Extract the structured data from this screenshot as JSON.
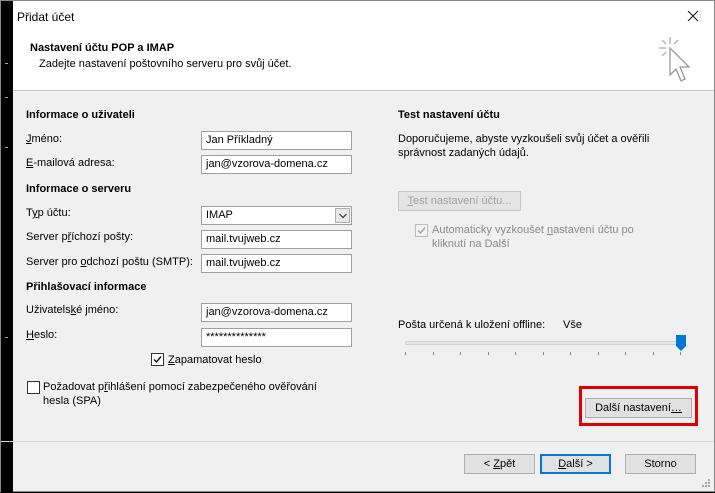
{
  "window": {
    "title": "Přidat účet"
  },
  "header": {
    "title": "Nastavení účtu POP a IMAP",
    "subtitle": "Zadejte nastavení poštovního serveru pro svůj účet."
  },
  "user_info": {
    "section": "Informace o uživateli",
    "name_label_u": "J",
    "name_label_rest": "méno:",
    "name_value": "Jan Příkladný",
    "email_label_u": "E",
    "email_label_rest": "-mailová adresa:",
    "email_value": "jan@vzorova-domena.cz"
  },
  "server_info": {
    "section": "Informace o serveru",
    "type_label_pre": "T",
    "type_label_u": "y",
    "type_label_rest": "p účtu:",
    "type_value": "IMAP",
    "incoming_label_pre": "Server p",
    "incoming_label_u": "ř",
    "incoming_label_rest": "íchozí pošty:",
    "incoming_value": "mail.tvujweb.cz",
    "outgoing_label_pre": "Server pro ",
    "outgoing_label_u": "o",
    "outgoing_label_rest": "dchozí poštu (SMTP):",
    "outgoing_value": "mail.tvujweb.cz"
  },
  "login_info": {
    "section": "Přihlašovací informace",
    "username_label_pre": "Uživatels",
    "username_label_u": "k",
    "username_label_rest": "é jméno:",
    "username_value": "jan@vzorova-domena.cz",
    "password_label_u": "H",
    "password_label_rest": "eslo:",
    "password_value": "**************",
    "remember_u": "Z",
    "remember_rest": "apamatovat heslo",
    "remember_checked": true,
    "spa_line1_pre": "Požadovat p",
    "spa_line1_u": "ř",
    "spa_line1_rest": "ihlášení pomocí zabezpečeného ověřování",
    "spa_line2": "hesla (SPA)",
    "spa_checked": false
  },
  "test": {
    "section": "Test nastavení účtu",
    "desc_line1": "Doporučujeme, abyste vyzkoušeli svůj účet a ověřili",
    "desc_line2": "správnost zadaných údajů.",
    "button_u": "T",
    "button_rest": "est nastavení účtu...",
    "auto_line1_pre": "Automaticky vyzkoušet ",
    "auto_line1_u": "n",
    "auto_line1_rest": "astavení účtu po",
    "auto_line2": "kliknutí na Další",
    "auto_checked": true
  },
  "offline": {
    "label": "Pošta určená k uložení offline:",
    "value": "Vše",
    "slider_position": 1.0
  },
  "more_settings": {
    "label_pre": "Další nastavení",
    "label_u": "…"
  },
  "footer": {
    "back_pre": "< ",
    "back_u": "Z",
    "back_rest": "pět",
    "next_pre": "",
    "next_u": "D",
    "next_rest": "alší >",
    "cancel": "Storno"
  },
  "colors": {
    "highlight": "#e00000",
    "accent": "#0078d7",
    "slider_thumb": "#0078d7"
  }
}
